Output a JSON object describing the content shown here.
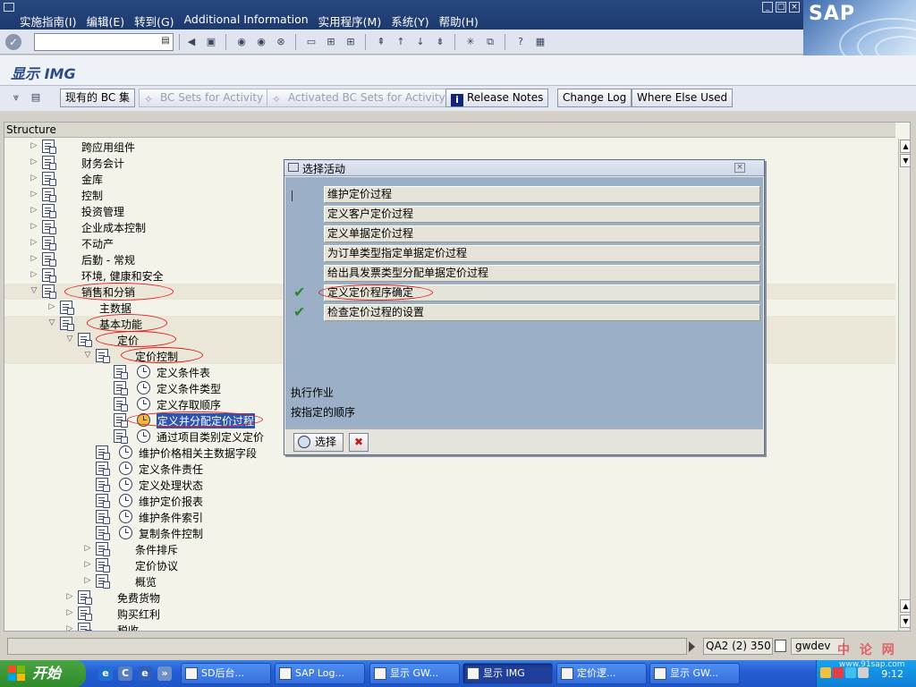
{
  "menubar": {
    "items": [
      "实施指南(I)",
      "编辑(E)",
      "转到(G)",
      "Additional Information",
      "实用程序(M)",
      "系统(Y)",
      "帮助(H)"
    ],
    "logo": "SAP"
  },
  "title": "显示 IMG",
  "app_toolbar": {
    "buttons": [
      {
        "label": "现有的 BC 集",
        "enabled": true
      },
      {
        "label": "BC Sets for Activity",
        "enabled": false
      },
      {
        "label": "Activated BC Sets for Activity",
        "enabled": false
      },
      {
        "label": "Release Notes",
        "enabled": true
      },
      {
        "label": "Change Log",
        "enabled": true
      },
      {
        "label": "Where Else Used",
        "enabled": true
      }
    ]
  },
  "tree": {
    "header": "Structure",
    "items": [
      {
        "label": "跨应用组件",
        "level": 0,
        "expand": "collapsed",
        "activity": false
      },
      {
        "label": "财务会计",
        "level": 0,
        "expand": "collapsed",
        "activity": false
      },
      {
        "label": "金库",
        "level": 0,
        "expand": "collapsed",
        "activity": false
      },
      {
        "label": "控制",
        "level": 0,
        "expand": "collapsed",
        "activity": false
      },
      {
        "label": "投资管理",
        "level": 0,
        "expand": "collapsed",
        "activity": false
      },
      {
        "label": "企业成本控制",
        "level": 0,
        "expand": "collapsed",
        "activity": false
      },
      {
        "label": "不动产",
        "level": 0,
        "expand": "collapsed",
        "activity": false
      },
      {
        "label": "后勤 - 常规",
        "level": 0,
        "expand": "collapsed",
        "activity": false
      },
      {
        "label": "环境, 健康和安全",
        "level": 0,
        "expand": "collapsed",
        "activity": false
      },
      {
        "label": "销售和分销",
        "level": 0,
        "expand": "expanded",
        "activity": false
      },
      {
        "label": "主数据",
        "level": 1,
        "expand": "collapsed",
        "activity": false
      },
      {
        "label": "基本功能",
        "level": 1,
        "expand": "expanded",
        "activity": false
      },
      {
        "label": "定价",
        "level": 2,
        "expand": "expanded",
        "activity": false
      },
      {
        "label": "定价控制",
        "level": 3,
        "expand": "expanded",
        "activity": false
      },
      {
        "label": "定义条件表",
        "level": 4,
        "expand": "none",
        "activity": true
      },
      {
        "label": "定义条件类型",
        "level": 4,
        "expand": "none",
        "activity": true
      },
      {
        "label": "定义存取顺序",
        "level": 4,
        "expand": "none",
        "activity": true
      },
      {
        "label": "定义并分配定价过程",
        "level": 4,
        "expand": "none",
        "activity": true,
        "highlight": true
      },
      {
        "label": "通过项目类别定义定价",
        "level": 4,
        "expand": "none",
        "activity": true
      },
      {
        "label": "维护价格相关主数据字段",
        "level": 3,
        "expand": "none",
        "activity": true
      },
      {
        "label": "定义条件责任",
        "level": 3,
        "expand": "none",
        "activity": true
      },
      {
        "label": "定义处理状态",
        "level": 3,
        "expand": "none",
        "activity": true
      },
      {
        "label": "维护定价报表",
        "level": 3,
        "expand": "none",
        "activity": true
      },
      {
        "label": "维护条件索引",
        "level": 3,
        "expand": "none",
        "activity": true
      },
      {
        "label": "复制条件控制",
        "level": 3,
        "expand": "none",
        "activity": true
      },
      {
        "label": "条件排斥",
        "level": 3,
        "expand": "collapsed",
        "activity": false
      },
      {
        "label": "定价协议",
        "level": 3,
        "expand": "collapsed",
        "activity": false
      },
      {
        "label": "概览",
        "level": 3,
        "expand": "collapsed",
        "activity": false
      },
      {
        "label": "免费货物",
        "level": 2,
        "expand": "collapsed",
        "activity": false
      },
      {
        "label": "购买红利",
        "level": 2,
        "expand": "collapsed",
        "activity": false
      },
      {
        "label": "税收",
        "level": 2,
        "expand": "collapsed",
        "activity": false
      }
    ]
  },
  "dialog": {
    "title": "选择活动",
    "activities": [
      {
        "label": "维护定价过程",
        "done": false
      },
      {
        "label": "定义客户定价过程",
        "done": false
      },
      {
        "label": "定义单据定价过程",
        "done": false
      },
      {
        "label": "为订单类型指定单据定价过程",
        "done": false
      },
      {
        "label": "给出具发票类型分配单据定价过程",
        "done": false
      },
      {
        "label": "定义定价程序确定",
        "done": true
      },
      {
        "label": "检查定价过程的设置",
        "done": true
      }
    ],
    "note1": "执行作业",
    "note2": "按指定的顺序",
    "select_label": "选择"
  },
  "statusbar": {
    "system": "QA2 (2) 350",
    "host": "gwdev"
  },
  "taskbar": {
    "start_label": "开始",
    "tasks": [
      "SD后台...",
      "SAP Log...",
      "显示 GW...",
      "显示 IMG",
      "定价逻...",
      "显示 GW..."
    ],
    "active_index": 3,
    "clock": "9:12"
  },
  "watermark": {
    "text": "中 论 网",
    "url": "www.91sap.com"
  },
  "colors": {
    "menubar": "#1d3a6e",
    "title": "#2a4a88",
    "dialog_body": "#9bb0c6",
    "annotation": "#e02020",
    "check": "#2a8a2a",
    "highlight": "#2d55b0"
  }
}
